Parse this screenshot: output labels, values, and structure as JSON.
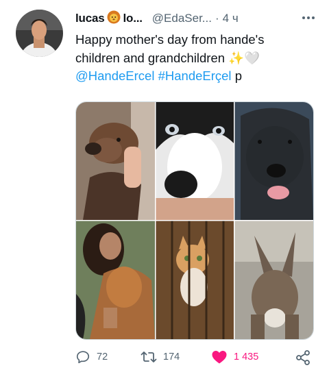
{
  "tweet": {
    "display_name": "lucas",
    "name_suffix": "lo...",
    "handle": "@EdaSer...",
    "separator": "·",
    "time": "4 ч",
    "more_icon": "more-dots-icon",
    "text_line1": "Happy mother's day from hande's",
    "text_line2": "children and grandchildren",
    "emoji_sparkles": "✨",
    "emoji_heart": "🤍",
    "mention": "@HandeErcel",
    "hashtag": "#HandeErçel",
    "trailing": "p"
  },
  "media": {
    "tiles": [
      "brown dog",
      "black-and-white dog",
      "black dog",
      "woman with dog",
      "kitten in basket",
      "donkey"
    ]
  },
  "actions": {
    "reply_count": "72",
    "retweet_count": "174",
    "like_count": "1 435",
    "like_color": "#f91880"
  }
}
